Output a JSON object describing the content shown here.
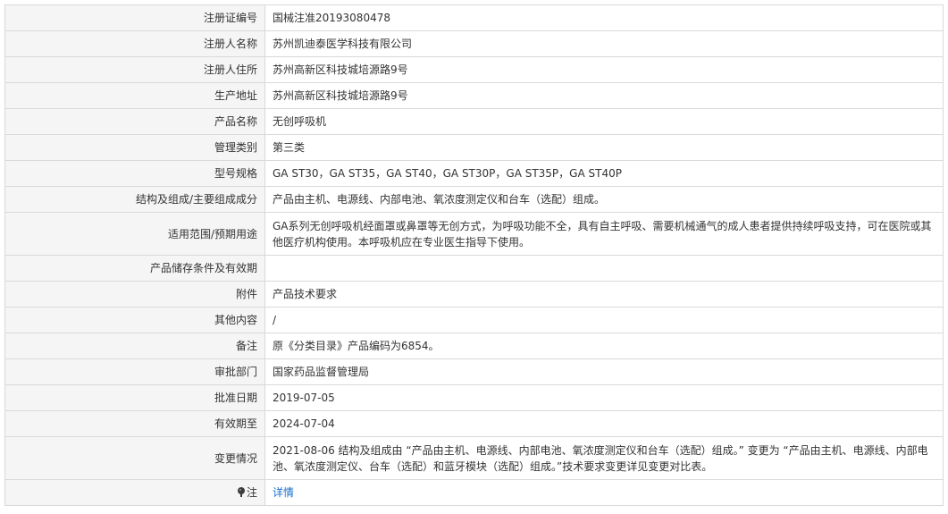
{
  "record": {
    "rows": [
      {
        "label": "注册证编号",
        "value": "国械注准20193080478"
      },
      {
        "label": "注册人名称",
        "value": "苏州凯迪泰医学科技有限公司"
      },
      {
        "label": "注册人住所",
        "value": "苏州高新区科技城培源路9号"
      },
      {
        "label": "生产地址",
        "value": "苏州高新区科技城培源路9号"
      },
      {
        "label": "产品名称",
        "value": "无创呼吸机"
      },
      {
        "label": "管理类别",
        "value": "第三类"
      },
      {
        "label": "型号规格",
        "value": "GA ST30，GA ST35，GA ST40，GA ST30P，GA ST35P，GA ST40P"
      },
      {
        "label": "结构及组成/主要组成成分",
        "value": "产品由主机、电源线、内部电池、氧浓度测定仪和台车（选配）组成。"
      },
      {
        "label": "适用范围/预期用途",
        "value": "GA系列无创呼吸机经面罩或鼻罩等无创方式，为呼吸功能不全，具有自主呼吸、需要机械通气的成人患者提供持续呼吸支持，可在医院或其他医疗机构使用。本呼吸机应在专业医生指导下使用。"
      },
      {
        "label": "产品储存条件及有效期",
        "value": ""
      },
      {
        "label": "附件",
        "value": "产品技术要求"
      },
      {
        "label": "其他内容",
        "value": "/"
      },
      {
        "label": "备注",
        "value": "原《分类目录》产品编码为6854。"
      },
      {
        "label": "审批部门",
        "value": "国家药品监督管理局"
      },
      {
        "label": "批准日期",
        "value": "2019-07-05"
      },
      {
        "label": "有效期至",
        "value": "2024-07-04"
      },
      {
        "label": "变更情况",
        "value": "2021-08-06 结构及组成由 “产品由主机、电源线、内部电池、氧浓度测定仪和台车（选配）组成。” 变更为 “产品由主机、电源线、内部电池、氧浓度测定仪、台车（选配）和蓝牙模块（选配）组成。”技术要求变更详见变更对比表。"
      }
    ],
    "note": {
      "label": "注",
      "icon": "pin-icon",
      "link_text": "详情"
    }
  },
  "colors": {
    "label_bg": "#f5f5f5",
    "border": "#d9d9d9",
    "link": "#1a6fc9",
    "text": "#333333"
  }
}
